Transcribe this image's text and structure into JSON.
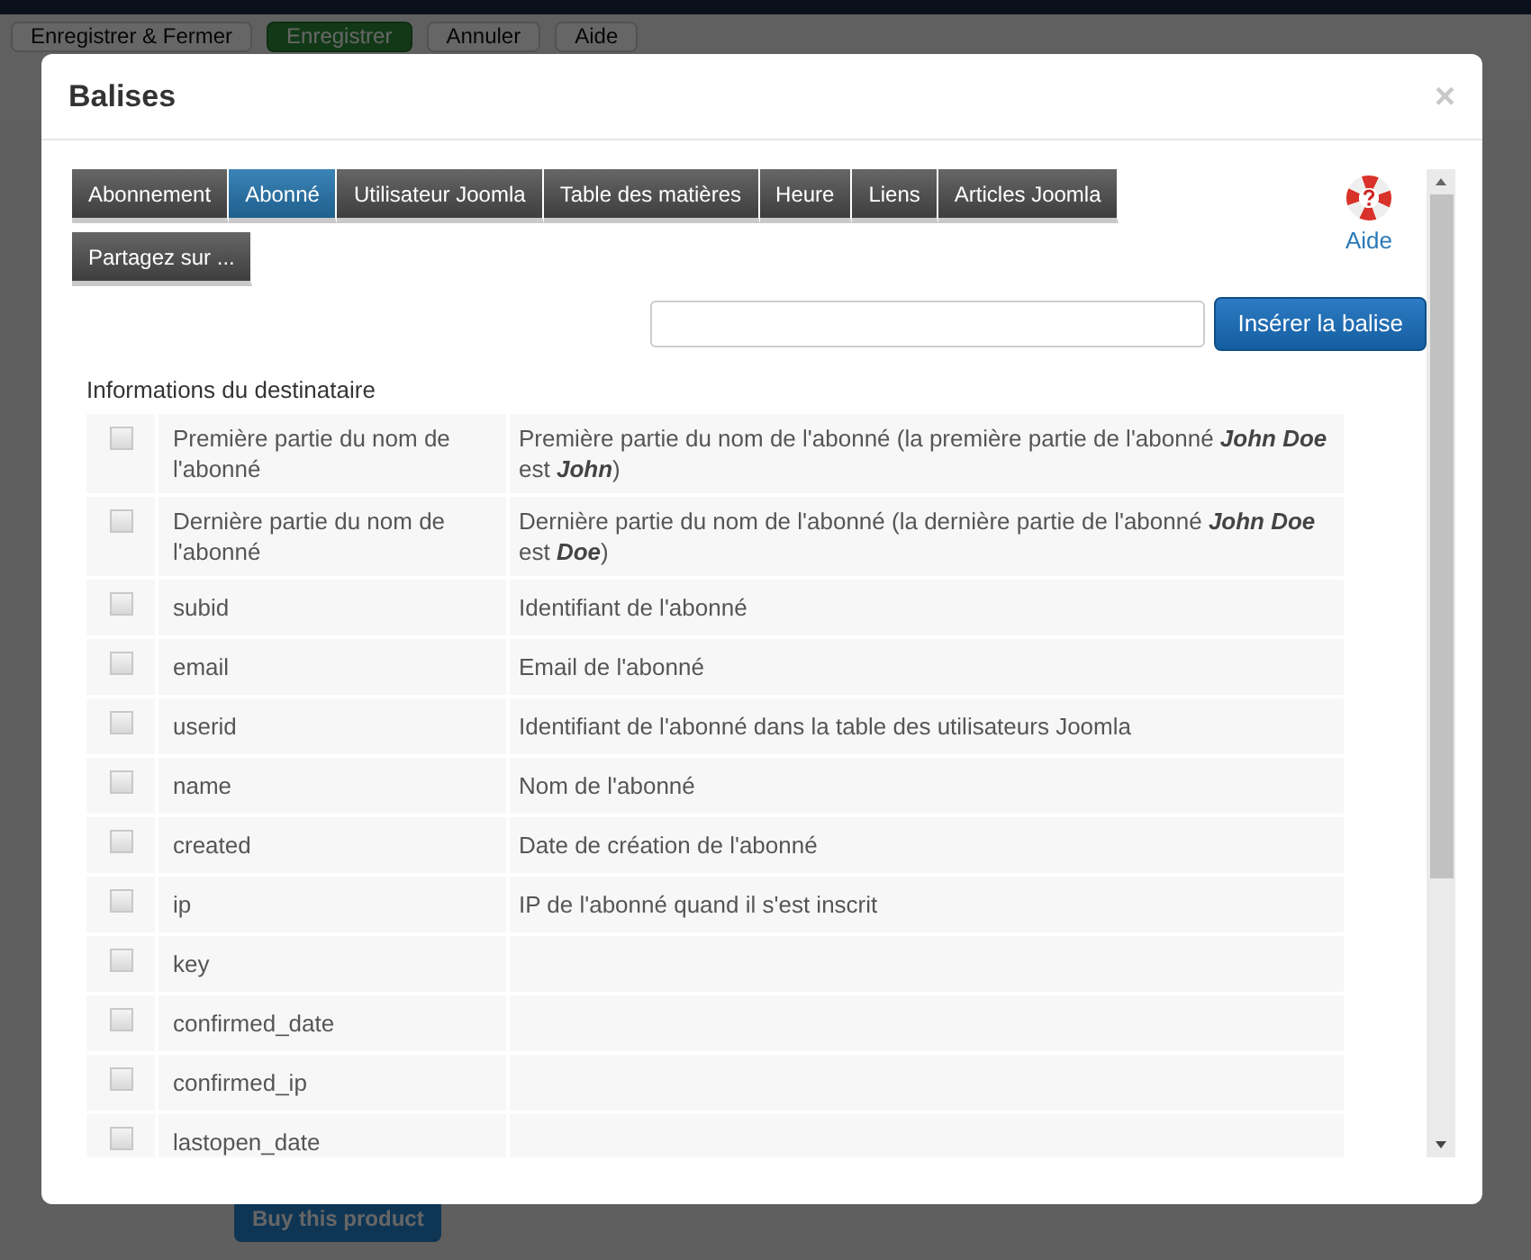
{
  "background": {
    "toolbar": [
      "Enregistrer & Fermer",
      "Enregistrer",
      "Annuler",
      "Aide"
    ],
    "product_button": "Buy this product"
  },
  "dialog": {
    "title": "Balises",
    "close": "×"
  },
  "tabs": [
    {
      "label": "Abonnement",
      "selected": false
    },
    {
      "label": "Abonné",
      "selected": true
    },
    {
      "label": "Utilisateur Joomla",
      "selected": false
    },
    {
      "label": "Table des matières",
      "selected": false
    },
    {
      "label": "Heure",
      "selected": false
    },
    {
      "label": "Liens",
      "selected": false
    },
    {
      "label": "Articles Joomla",
      "selected": false
    },
    {
      "label": "Partagez sur ...",
      "selected": false
    }
  ],
  "help": {
    "label": "Aide"
  },
  "insert_button": "Insérer la balise",
  "section_title": "Informations du destinataire",
  "rows": [
    {
      "checked": false,
      "tag": "Première partie du nom de l'abonné",
      "description": "Première partie du nom de l'abonné (la première partie de l'abonné **John Doe** est **John**)"
    },
    {
      "checked": false,
      "tag": "Dernière partie du nom de l'abonné",
      "description": "Dernière partie du nom de l'abonné (la dernière partie de l'abonné **John Doe** est **Doe**)"
    },
    {
      "checked": false,
      "tag": "subid",
      "description": "Identifiant de l'abonné"
    },
    {
      "checked": false,
      "tag": "email",
      "description": "Email de l'abonné"
    },
    {
      "checked": false,
      "tag": "userid",
      "description": "Identifiant de l'abonné dans la table des utilisateurs Joomla"
    },
    {
      "checked": false,
      "tag": "name",
      "description": "Nom de l'abonné"
    },
    {
      "checked": false,
      "tag": "created",
      "description": "Date de création de l'abonné"
    },
    {
      "checked": false,
      "tag": "ip",
      "description": "IP de l'abonné quand il s'est inscrit"
    },
    {
      "checked": false,
      "tag": "key"
    },
    {
      "checked": false,
      "tag": "confirmed_date"
    },
    {
      "checked": false,
      "tag": "confirmed_ip"
    },
    {
      "checked": false,
      "tag": "lastopen_date"
    }
  ]
}
